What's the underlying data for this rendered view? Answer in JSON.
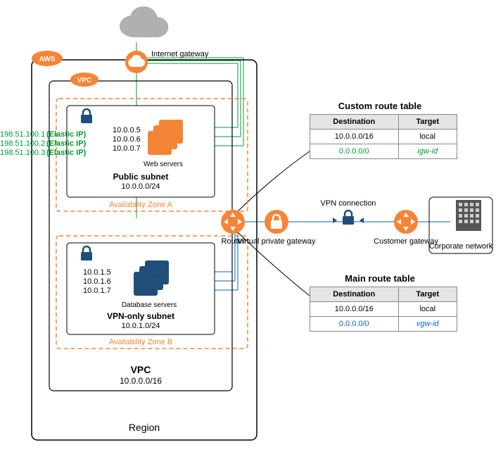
{
  "labels": {
    "aws": "AWS",
    "vpc": "VPC",
    "region": "Region",
    "igw": "Internet gateway",
    "router": "Router",
    "vgw": "Virtual private gateway",
    "vpn": "VPN connection",
    "cgw": "Customer gateway",
    "corpnet": "Corporate network",
    "pubsub": "Public subnet",
    "pubcidr": "10.0.0.0/24",
    "privsub": "VPN-only subnet",
    "privcidr": "10.0.1.0/24",
    "aza": "Availability Zone A",
    "azb": "Availability Zone B",
    "web": "Web servers",
    "db": "Database servers",
    "vpc_title": "VPC",
    "vpc_cidr": "10.0.0.0/16",
    "crt_title": "Custom route table",
    "mrt_title": "Main route table",
    "destcol": "Destination",
    "tgtcol": "Target"
  },
  "webips": [
    "10.0.0.5",
    "10.0.0.6",
    "10.0.0.7"
  ],
  "dbips": [
    "10.0.1.5",
    "10.0.1.6",
    "10.0.1.7"
  ],
  "eips": [
    {
      "ip": "198.51.100.1",
      "tag": "(Elastic IP)"
    },
    {
      "ip": "198.51.100.2",
      "tag": "(Elastic IP)"
    },
    {
      "ip": "198.51.100.3",
      "tag": "(Elastic IP)"
    }
  ],
  "crt": [
    {
      "dest": "10.0.0.0/16",
      "tgt": "local",
      "color": "#000"
    },
    {
      "dest": "0.0.0.0/0",
      "tgt": "igw-id",
      "color": "#009933",
      "italic": true
    }
  ],
  "mrt": [
    {
      "dest": "10.0.0.0/16",
      "tgt": "local",
      "color": "#000"
    },
    {
      "dest": "0.0.0.0/0",
      "tgt": "vgw-id",
      "color": "#0066cc",
      "italic": true
    }
  ],
  "colors": {
    "orange": "#f58536",
    "blue": "#1f4e79",
    "green": "#009933",
    "grey": "#888"
  }
}
